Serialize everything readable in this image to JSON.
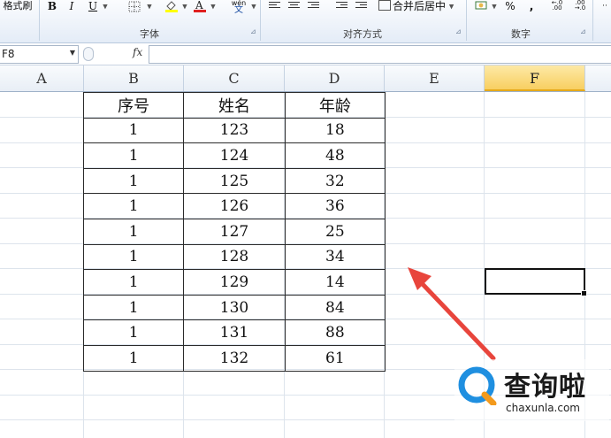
{
  "ribbon": {
    "format_painter": "格式刷",
    "bold": "B",
    "italic": "I",
    "underline": "U",
    "phonetic": "wén",
    "merge_center": "合并后居中",
    "percent": "%",
    "comma": ",",
    "groups": {
      "font": "字体",
      "alignment": "对齐方式",
      "number": "数字"
    }
  },
  "formula_bar": {
    "name_box": "F8",
    "fx": "fx",
    "content": ""
  },
  "columns": [
    "A",
    "B",
    "C",
    "D",
    "E",
    "F"
  ],
  "selected_column": "F",
  "table": {
    "headers": [
      "序号",
      "姓名",
      "年龄"
    ],
    "rows": [
      [
        "1",
        "123",
        "18"
      ],
      [
        "1",
        "124",
        "48"
      ],
      [
        "1",
        "125",
        "32"
      ],
      [
        "1",
        "126",
        "36"
      ],
      [
        "1",
        "127",
        "25"
      ],
      [
        "1",
        "128",
        "34"
      ],
      [
        "1",
        "129",
        "14"
      ],
      [
        "1",
        "130",
        "84"
      ],
      [
        "1",
        "131",
        "88"
      ],
      [
        "1",
        "132",
        "61"
      ]
    ]
  },
  "colors": {
    "arrow": "#e8453c",
    "selected_header": "#f8cf61",
    "watermark_blue": "#1f8fe0",
    "watermark_orange": "#f39a1d"
  },
  "watermark": {
    "name": "查询啦",
    "url": "chaxunla.com"
  }
}
